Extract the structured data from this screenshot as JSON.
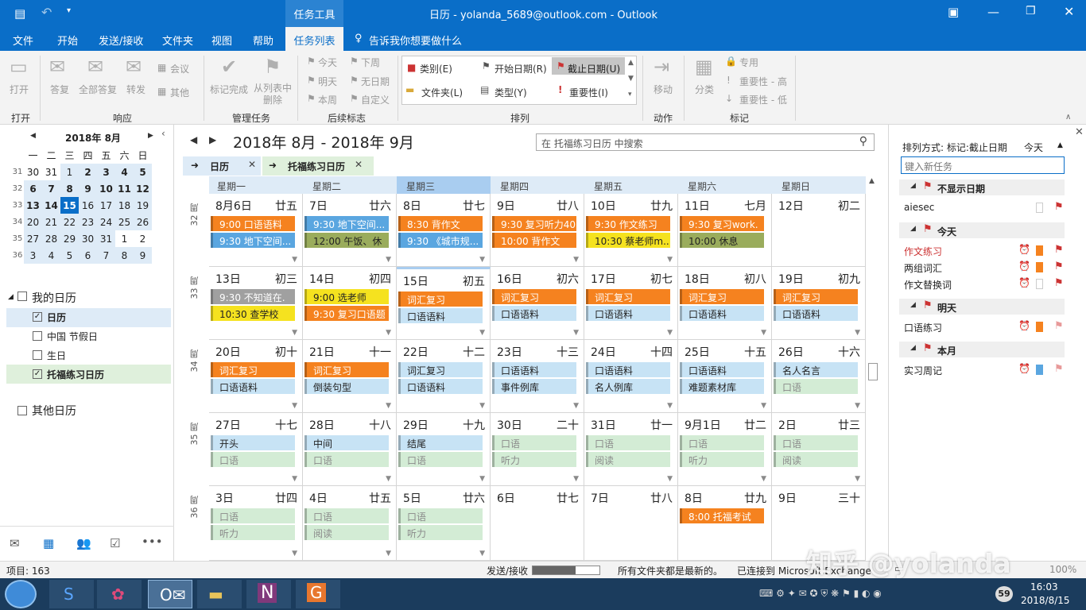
{
  "app": {
    "window_title": "日历 - yolanda_5689@outlook.com  -  Outlook",
    "context_tab": "任务工具",
    "tell_me": "告诉我你想要做什么"
  },
  "menu": {
    "items": [
      "文件",
      "开始",
      "发送/接收",
      "文件夹",
      "视图",
      "帮助",
      "任务列表"
    ],
    "active": "任务列表"
  },
  "ribbon": {
    "open": {
      "label": "打开",
      "group": "打开"
    },
    "respond": {
      "reply": "答复",
      "reply_all": "全部答复",
      "forward": "转发",
      "meeting": "会议",
      "more": "其他",
      "group": "响应"
    },
    "manage": {
      "complete": "标记完成",
      "remove": "从列表中删除",
      "group": "管理任务"
    },
    "followup": {
      "today": "今天",
      "next_week": "下周",
      "tomorrow": "明天",
      "no_date": "无日期",
      "this_week": "本周",
      "custom": "自定义",
      "group": "后续标志"
    },
    "arrange": {
      "category": "类别(E)",
      "start": "开始日期(R)",
      "due": "截止日期(U)",
      "folder": "文件夹(L)",
      "type": "类型(Y)",
      "importance": "重要性(I)",
      "group": "排列"
    },
    "action": {
      "move": "移动",
      "group": "动作"
    },
    "tags": {
      "categorize": "分类",
      "private": "专用",
      "high": "重要性 - 高",
      "low": "重要性 - 低",
      "group": "标记"
    }
  },
  "mini_cal": {
    "title": "2018年 8月",
    "weekdays": [
      "一",
      "二",
      "三",
      "四",
      "五",
      "六",
      "日"
    ],
    "rows": [
      {
        "wk": "31",
        "days": [
          "30",
          "31",
          "1",
          "2",
          "3",
          "4",
          "5"
        ]
      },
      {
        "wk": "32",
        "days": [
          "6",
          "7",
          "8",
          "9",
          "10",
          "11",
          "12"
        ]
      },
      {
        "wk": "33",
        "days": [
          "13",
          "14",
          "15",
          "16",
          "17",
          "18",
          "19"
        ]
      },
      {
        "wk": "34",
        "days": [
          "20",
          "21",
          "22",
          "23",
          "24",
          "25",
          "26"
        ]
      },
      {
        "wk": "35",
        "days": [
          "27",
          "28",
          "29",
          "30",
          "31",
          "1",
          "2"
        ]
      },
      {
        "wk": "36",
        "days": [
          "3",
          "4",
          "5",
          "6",
          "7",
          "8",
          "9"
        ]
      }
    ],
    "today": "15"
  },
  "folders": {
    "my_cal": "我的日历",
    "items": [
      {
        "name": "日历",
        "checked": true
      },
      {
        "name": "中国 节假日",
        "checked": false
      },
      {
        "name": "生日",
        "checked": false
      },
      {
        "name": "托福练习日历",
        "checked": true
      }
    ],
    "other": "其他日历"
  },
  "calendar": {
    "range_title": "2018年 8月 - 2018年 9月",
    "search_placeholder": "在 托福练习日历 中搜索",
    "tabs": [
      "日历",
      "托福练习日历"
    ],
    "weekdays": [
      "星期一",
      "星期二",
      "星期三",
      "星期四",
      "星期五",
      "星期六",
      "星期日"
    ],
    "weeks": [
      {
        "num": "32 周",
        "days": [
          {
            "d": "8月6日",
            "l": "廿五",
            "ev": [
              {
                "t": "9:00 口语语料",
                "c": "#f5821f"
              },
              {
                "t": "9:30 地下空间...",
                "c": "#5aa6e0"
              }
            ],
            "more": true
          },
          {
            "d": "7日",
            "l": "廿六",
            "ev": [
              {
                "t": "9:30 地下空间...",
                "c": "#5aa6e0"
              },
              {
                "t": "12:00 午饭、休",
                "c": "#9aac5c"
              }
            ],
            "more": true
          },
          {
            "d": "8日",
            "l": "廿七",
            "ev": [
              {
                "t": "8:30 背作文",
                "c": "#f5821f"
              },
              {
                "t": "9:30 《城市规...",
                "c": "#5aa6e0"
              }
            ],
            "more": true
          },
          {
            "d": "9日",
            "l": "廿八",
            "ev": [
              {
                "t": "9:30 复习听力40",
                "c": "#f5821f"
              },
              {
                "t": "10:00 背作文",
                "c": "#f5821f"
              }
            ],
            "more": true
          },
          {
            "d": "10日",
            "l": "廿九",
            "ev": [
              {
                "t": "9:30 作文练习",
                "c": "#f5821f"
              },
              {
                "t": "10:30 蔡老师m...",
                "c": "#f5e21f"
              }
            ],
            "more": true
          },
          {
            "d": "11日",
            "l": "七月",
            "ev": [
              {
                "t": "9:30 复习work.",
                "c": "#f5821f"
              },
              {
                "t": "10:00 休息",
                "c": "#9aac5c"
              }
            ],
            "more": false
          },
          {
            "d": "12日",
            "l": "初二",
            "ev": [],
            "more": false
          }
        ]
      },
      {
        "num": "33 周",
        "days": [
          {
            "d": "13日",
            "l": "初三",
            "ev": [
              {
                "t": "9:30 不知道在.",
                "c": "#a0a0a0"
              },
              {
                "t": "10:30 查学校",
                "c": "#f5e21f"
              }
            ],
            "more": true
          },
          {
            "d": "14日",
            "l": "初四",
            "ev": [
              {
                "t": "9:00 选老师",
                "c": "#f5e21f"
              },
              {
                "t": "9:30 复习口语题",
                "c": "#f5821f"
              }
            ],
            "more": true
          },
          {
            "d": "15日",
            "l": "初五",
            "ev": [
              {
                "t": "词汇复习",
                "c": "#f5821f"
              },
              {
                "t": "口语语料",
                "c": "#c7e3f5"
              }
            ],
            "more": true
          },
          {
            "d": "16日",
            "l": "初六",
            "ev": [
              {
                "t": "词汇复习",
                "c": "#f5821f"
              },
              {
                "t": "口语语料",
                "c": "#c7e3f5"
              }
            ],
            "more": true
          },
          {
            "d": "17日",
            "l": "初七",
            "ev": [
              {
                "t": "词汇复习",
                "c": "#f5821f"
              },
              {
                "t": "口语语料",
                "c": "#c7e3f5"
              }
            ],
            "more": true
          },
          {
            "d": "18日",
            "l": "初八",
            "ev": [
              {
                "t": "词汇复习",
                "c": "#f5821f"
              },
              {
                "t": "口语语料",
                "c": "#c7e3f5"
              }
            ],
            "more": true
          },
          {
            "d": "19日",
            "l": "初九",
            "ev": [
              {
                "t": "词汇复习",
                "c": "#f5821f"
              },
              {
                "t": "口语语料",
                "c": "#c7e3f5"
              }
            ],
            "more": true
          }
        ]
      },
      {
        "num": "34 周",
        "days": [
          {
            "d": "20日",
            "l": "初十",
            "ev": [
              {
                "t": "词汇复习",
                "c": "#f5821f"
              },
              {
                "t": "口语语料",
                "c": "#c7e3f5"
              }
            ],
            "more": true
          },
          {
            "d": "21日",
            "l": "十一",
            "ev": [
              {
                "t": "词汇复习",
                "c": "#f5821f"
              },
              {
                "t": "倒装句型",
                "c": "#c7e3f5"
              }
            ],
            "more": true
          },
          {
            "d": "22日",
            "l": "十二",
            "ev": [
              {
                "t": "词汇复习",
                "c": "#c7e3f5"
              },
              {
                "t": "口语语料",
                "c": "#c7e3f5"
              }
            ],
            "more": true
          },
          {
            "d": "23日",
            "l": "十三",
            "ev": [
              {
                "t": "口语语料",
                "c": "#c7e3f5"
              },
              {
                "t": "事件例库",
                "c": "#c7e3f5"
              }
            ],
            "more": true
          },
          {
            "d": "24日",
            "l": "十四",
            "ev": [
              {
                "t": "口语语料",
                "c": "#c7e3f5"
              },
              {
                "t": "名人例库",
                "c": "#c7e3f5"
              }
            ],
            "more": true
          },
          {
            "d": "25日",
            "l": "十五",
            "ev": [
              {
                "t": "口语语料",
                "c": "#c7e3f5"
              },
              {
                "t": "难题素材库",
                "c": "#c7e3f5"
              }
            ],
            "more": true
          },
          {
            "d": "26日",
            "l": "十六",
            "ev": [
              {
                "t": "名人名言",
                "c": "#c7e3f5"
              },
              {
                "t": "口语",
                "c": "#d3ecd5"
              }
            ],
            "more": true
          }
        ]
      },
      {
        "num": "35 周",
        "days": [
          {
            "d": "27日",
            "l": "十七",
            "ev": [
              {
                "t": "开头",
                "c": "#c7e3f5"
              },
              {
                "t": "口语",
                "c": "#d3ecd5"
              }
            ],
            "more": true
          },
          {
            "d": "28日",
            "l": "十八",
            "ev": [
              {
                "t": "中间",
                "c": "#c7e3f5"
              },
              {
                "t": "口语",
                "c": "#d3ecd5"
              }
            ],
            "more": true
          },
          {
            "d": "29日",
            "l": "十九",
            "ev": [
              {
                "t": "结尾",
                "c": "#c7e3f5"
              },
              {
                "t": "口语",
                "c": "#d3ecd5"
              }
            ],
            "more": true
          },
          {
            "d": "30日",
            "l": "二十",
            "ev": [
              {
                "t": "口语",
                "c": "#d3ecd5"
              },
              {
                "t": "听力",
                "c": "#d3ecd5"
              }
            ],
            "more": true
          },
          {
            "d": "31日",
            "l": "廿一",
            "ev": [
              {
                "t": "口语",
                "c": "#d3ecd5"
              },
              {
                "t": "阅读",
                "c": "#d3ecd5"
              }
            ],
            "more": true
          },
          {
            "d": "9月1日",
            "l": "廿二",
            "ev": [
              {
                "t": "口语",
                "c": "#d3ecd5"
              },
              {
                "t": "听力",
                "c": "#d3ecd5"
              }
            ],
            "more": true
          },
          {
            "d": "2日",
            "l": "廿三",
            "ev": [
              {
                "t": "口语",
                "c": "#d3ecd5"
              },
              {
                "t": "阅读",
                "c": "#d3ecd5"
              }
            ],
            "more": true
          }
        ]
      },
      {
        "num": "36 周",
        "days": [
          {
            "d": "3日",
            "l": "廿四",
            "ev": [
              {
                "t": "口语",
                "c": "#d3ecd5"
              },
              {
                "t": "听力",
                "c": "#d3ecd5"
              }
            ],
            "more": true
          },
          {
            "d": "4日",
            "l": "廿五",
            "ev": [
              {
                "t": "口语",
                "c": "#d3ecd5"
              },
              {
                "t": "阅读",
                "c": "#d3ecd5"
              }
            ],
            "more": true
          },
          {
            "d": "5日",
            "l": "廿六",
            "ev": [
              {
                "t": "口语",
                "c": "#d3ecd5"
              },
              {
                "t": "听力",
                "c": "#d3ecd5"
              }
            ],
            "more": true
          },
          {
            "d": "6日",
            "l": "廿七",
            "ev": [],
            "more": false
          },
          {
            "d": "7日",
            "l": "廿八",
            "ev": [],
            "more": false
          },
          {
            "d": "8日",
            "l": "廿九",
            "ev": [
              {
                "t": "8:00 托福考试",
                "c": "#f5821f"
              }
            ],
            "more": false
          },
          {
            "d": "9日",
            "l": "三十",
            "ev": [],
            "more": false
          }
        ]
      }
    ]
  },
  "tasks": {
    "sort_label": "排列方式: 标记:截止日期",
    "sort_value": "今天",
    "new_placeholder": "键入新任务",
    "groups": [
      {
        "name": "不显示日期",
        "items": [
          {
            "t": "aiesec",
            "red": false,
            "color": ""
          }
        ]
      },
      {
        "name": "今天",
        "items": [
          {
            "t": "作文练习",
            "red": true,
            "color": "#f5821f"
          },
          {
            "t": "两组词汇",
            "red": false,
            "color": "#f5821f"
          },
          {
            "t": "作文替换词",
            "red": false,
            "color": ""
          }
        ]
      },
      {
        "name": "明天",
        "items": [
          {
            "t": "口语练习",
            "red": false,
            "color": "#f5821f"
          }
        ]
      },
      {
        "name": "本月",
        "items": [
          {
            "t": "实习周记",
            "red": false,
            "color": "#5aa6e0"
          }
        ]
      }
    ]
  },
  "status": {
    "items_count": "项目: 163",
    "send_receive": "发送/接收",
    "up_to_date": "所有文件夹都是最新的。",
    "connected": "已连接到 Microsoft Exchange",
    "zoom": "100%",
    "watermark": "知乎 @yolanda"
  },
  "clock": {
    "time": "16:03",
    "date": "2018/8/15"
  }
}
